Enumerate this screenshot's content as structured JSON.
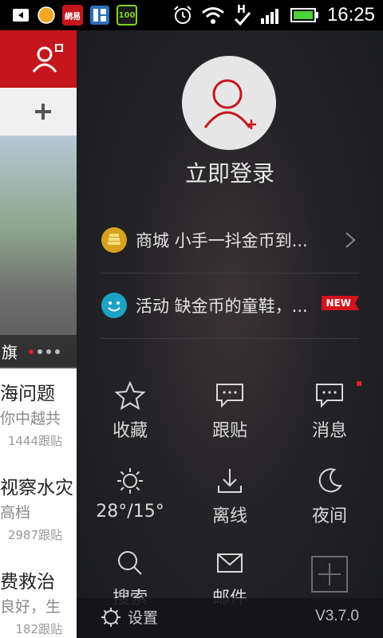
{
  "status_bar": {
    "time": "16:25",
    "icons": [
      "back-icon",
      "orange-circle-icon",
      "netease-icon",
      "film-icon",
      "100-app-icon",
      "alarm-icon",
      "wifi-icon",
      "data-h-icon",
      "check-icon",
      "signal-icon",
      "battery-icon"
    ],
    "netease_label": "網易",
    "app100_label": "100"
  },
  "background_app": {
    "photo_caption": "旗",
    "news": [
      {
        "title": "海问题",
        "subtitle": "你中越共",
        "count": "1444跟贴"
      },
      {
        "title": "视察水灾",
        "subtitle": "高档",
        "count": "2987跟贴"
      },
      {
        "title": "费救治",
        "subtitle": "良好，生",
        "count": "182跟贴"
      }
    ]
  },
  "drawer": {
    "login_label": "立即登录",
    "promos": [
      {
        "text": "商城  小手一抖金币到...",
        "icon": "gold-coins-icon",
        "has_chevron": true
      },
      {
        "text": "活动  缺金币的童鞋，...",
        "icon": "smiley-icon",
        "badge": "NEW"
      }
    ],
    "grid": [
      {
        "label": "收藏",
        "icon": "star-icon"
      },
      {
        "label": "跟贴",
        "icon": "comment-icon"
      },
      {
        "label": "消息",
        "icon": "message-icon"
      },
      {
        "label": "28°/15°",
        "icon": "sun-icon"
      },
      {
        "label": "离线",
        "icon": "download-icon"
      },
      {
        "label": "夜间",
        "icon": "moon-icon"
      },
      {
        "label": "搜索",
        "icon": "search-icon"
      },
      {
        "label": "邮件",
        "icon": "mail-icon"
      },
      {
        "label": "",
        "icon": "add-icon"
      }
    ],
    "settings_label": "设置",
    "version": "V3.7.0"
  },
  "colors": {
    "accent_red": "#c4161c",
    "badge_red": "#d4121b",
    "drawer_bg": "#1e1e22"
  }
}
